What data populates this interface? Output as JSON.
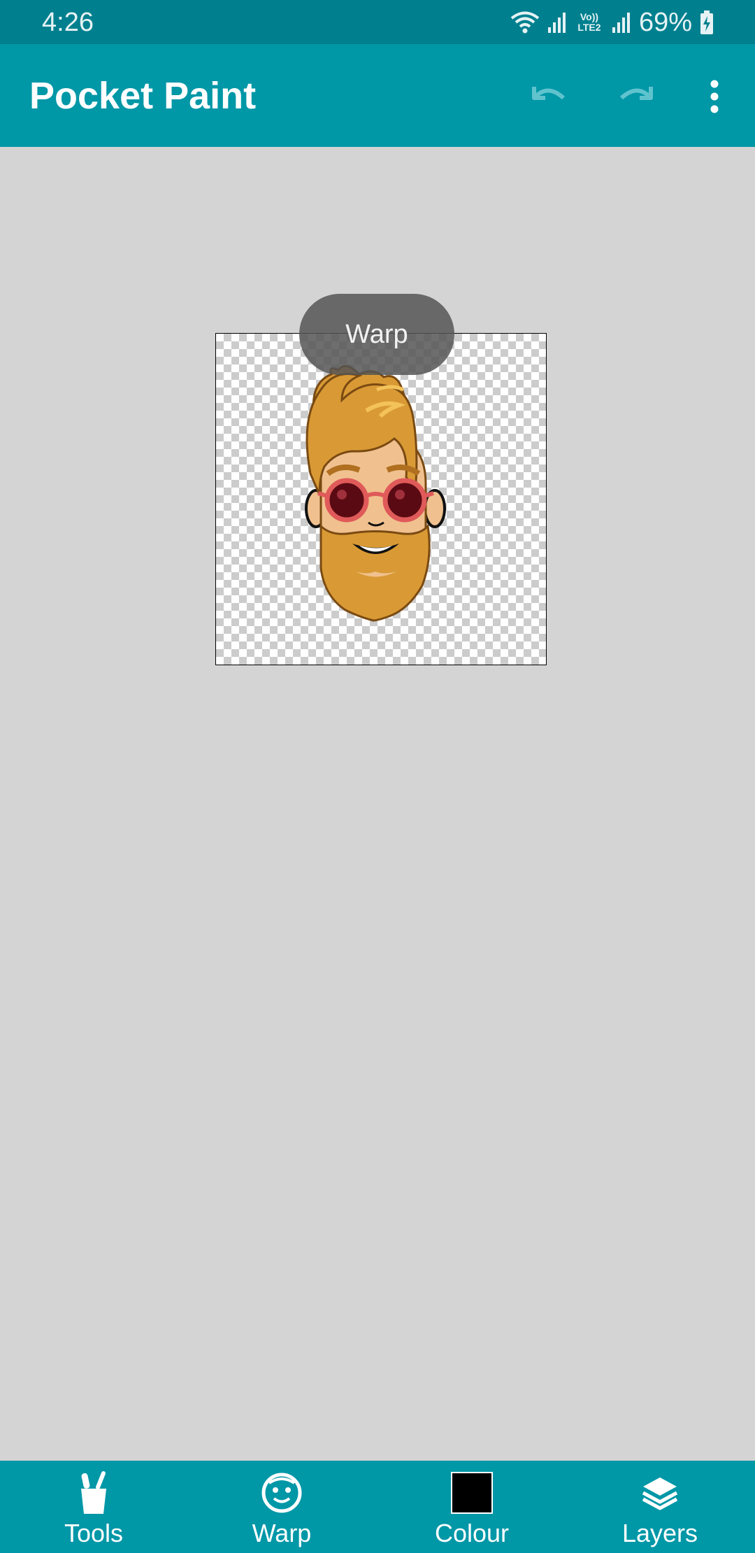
{
  "status_bar": {
    "time": "4:26",
    "network_label": "Vo)) LTE2",
    "battery": "69%"
  },
  "app_bar": {
    "title": "Pocket Paint",
    "undo_icon": "undo-icon",
    "redo_icon": "redo-icon",
    "menu_icon": "more-vert-icon"
  },
  "toast": {
    "text": "Warp"
  },
  "bottom_nav": {
    "items": [
      {
        "label": "Tools",
        "icon": "tools-icon"
      },
      {
        "label": "Warp",
        "icon": "warp-face-icon"
      },
      {
        "label": "Colour",
        "icon": "colour-swatch",
        "swatch_color": "#000000"
      },
      {
        "label": "Layers",
        "icon": "layers-icon"
      }
    ]
  },
  "colors": {
    "status_bar": "#00808f",
    "app_bar": "#0097a7",
    "background": "#d4d4d4"
  }
}
